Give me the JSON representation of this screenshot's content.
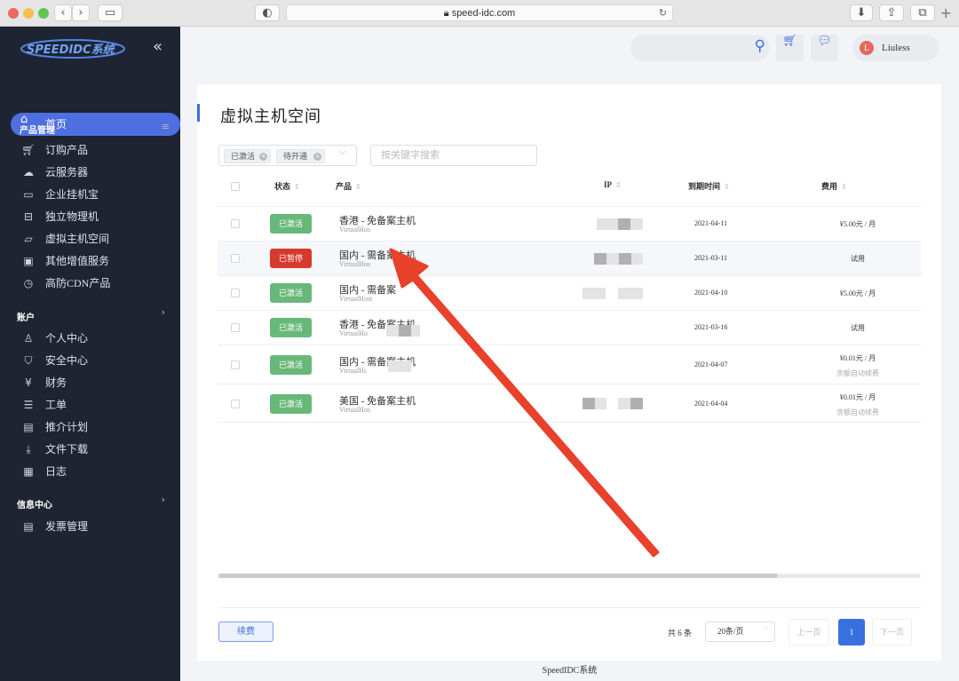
{
  "browser": {
    "url": "speed-idc.com"
  },
  "sidebar": {
    "logo_text": "SPEEDIDC系统",
    "home": "首页",
    "sections": [
      {
        "title": "产品管理",
        "items": [
          "订购产品",
          "云服务器",
          "企业挂机宝",
          "独立物理机",
          "虚拟主机空间",
          "其他增值服务",
          "高防CDN产品"
        ]
      },
      {
        "title": "账户",
        "items": [
          "个人中心",
          "安全中心",
          "财务",
          "工单",
          "推介计划",
          "文件下载",
          "日志"
        ]
      },
      {
        "title": "信息中心",
        "items": [
          "发票管理"
        ]
      }
    ]
  },
  "header": {
    "username": "Liuless",
    "avatar_letter": "L"
  },
  "page": {
    "title": "虚拟主机空间",
    "filter_tags": [
      "已激活",
      "待开通"
    ],
    "search_placeholder": "按关键字搜索",
    "columns": {
      "status": "状态",
      "product": "产品",
      "ip": "IP",
      "expire": "到期时间",
      "fee": "费用"
    },
    "rows": [
      {
        "status": "已激活",
        "product": "香港 - 免备案主机",
        "sub": "VirtualHos",
        "date": "2021-04-11",
        "fee": "¥5.00元 / 月",
        "fee_note": ""
      },
      {
        "status": "已暂停",
        "product": "国内 - 需备案主机",
        "sub": "VirtualHos",
        "date": "2021-03-11",
        "fee": "试用",
        "fee_note": ""
      },
      {
        "status": "已激活",
        "product": "国内 - 需备案",
        "sub": "VirtualHost",
        "date": "2021-04-10",
        "fee": "¥5.00元 / 月",
        "fee_note": ""
      },
      {
        "status": "已激活",
        "product": "香港 - 免备案主机",
        "sub": "VirtualHo",
        "date": "2021-03-16",
        "fee": "试用",
        "fee_note": ""
      },
      {
        "status": "已激活",
        "product": "国内 - 需备案主机",
        "sub": "VirtualHc",
        "date": "2021-04-07",
        "fee": "¥0.01元 / 月",
        "fee_note": "余额自动续费"
      },
      {
        "status": "已激活",
        "product": "美国 - 免备案主机",
        "sub": "VirtualHos",
        "date": "2021-04-04",
        "fee": "¥0.01元 / 月",
        "fee_note": "余额自动续费"
      }
    ],
    "renew_button": "续费",
    "total": "共 6 条",
    "page_size": "20条/页",
    "prev": "上一页",
    "current_page": "1",
    "next": "下一页"
  },
  "footer": "SpeedIDC系统",
  "colors": {
    "accent": "#3a6fe0",
    "sidebar": "#1f2433",
    "active": "#68b87a",
    "paused": "#d63a2c",
    "arrow": "#e8412c"
  }
}
